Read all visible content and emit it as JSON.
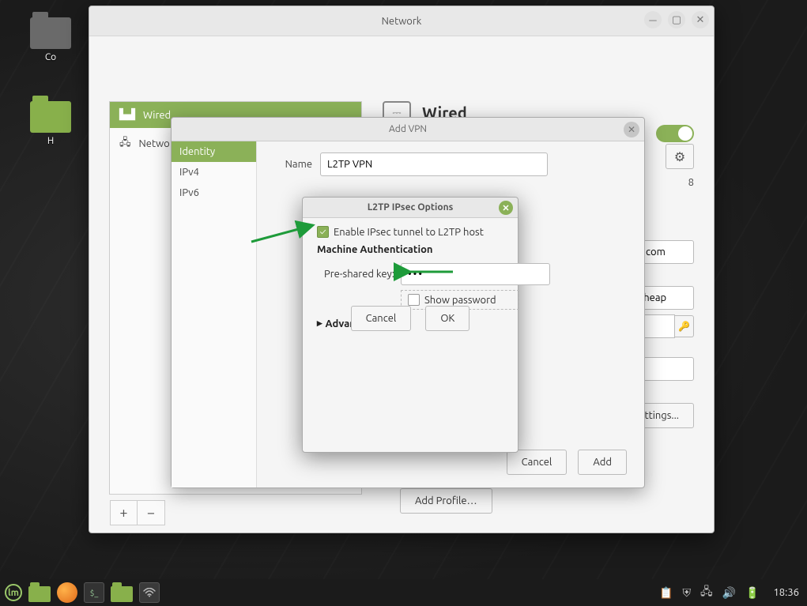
{
  "desktop": {
    "icons": [
      {
        "label": "Co"
      },
      {
        "label": "H"
      }
    ]
  },
  "network_window": {
    "title": "Network",
    "sidebar": {
      "items": [
        {
          "label": "Wired"
        },
        {
          "label": "Netwo"
        }
      ],
      "add_tooltip": "+",
      "remove_tooltip": "−"
    },
    "main": {
      "heading": "Wired",
      "connection_speed_fragment": "8",
      "gateway_fragment": "com",
      "user_fragment": "echeap",
      "ppp_settings_label": "P Settings...",
      "add_profile_label": "Add Profile…"
    },
    "toggle_on": true
  },
  "add_vpn_dialog": {
    "title": "Add VPN",
    "side_tabs": [
      "Identity",
      "IPv4",
      "IPv6"
    ],
    "name_label": "Name",
    "name_value": "L2TP VPN",
    "cancel_label": "Cancel",
    "add_label": "Add"
  },
  "ipsec_dialog": {
    "title": "L2TP IPsec Options",
    "enable_label": "Enable IPsec tunnel to L2TP host",
    "enable_checked": true,
    "section_heading": "Machine Authentication",
    "psk_label": "Pre-shared key:",
    "psk_value": "•••",
    "show_password_label": "Show password",
    "show_password_checked": false,
    "advanced_label": "Advanced",
    "cancel_label": "Cancel",
    "ok_label": "OK"
  },
  "taskbar": {
    "clock": "18:36"
  }
}
